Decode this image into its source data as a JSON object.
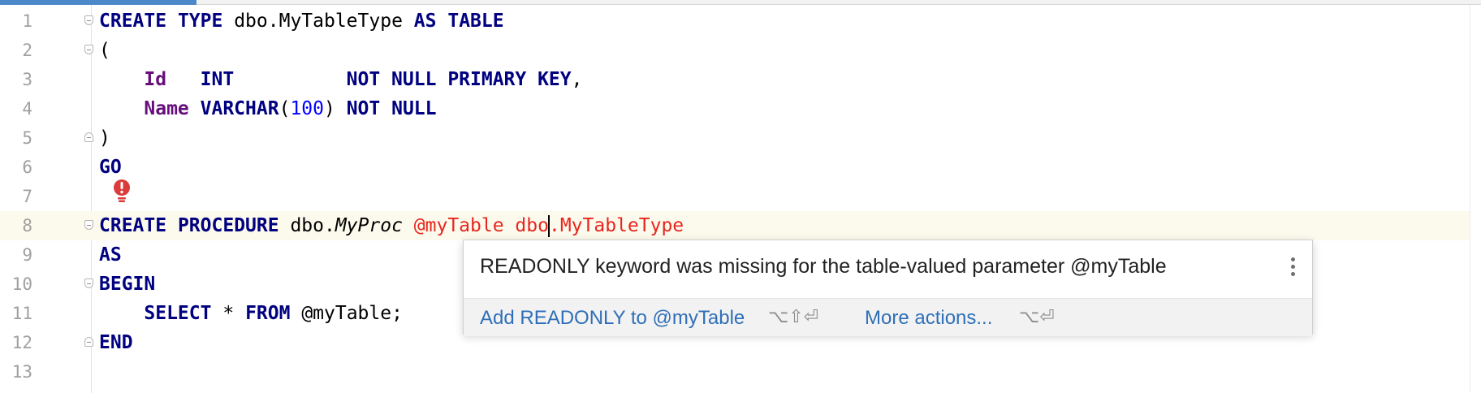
{
  "editor": {
    "line_numbers": [
      "1",
      "2",
      "3",
      "4",
      "5",
      "6",
      "7",
      "8",
      "9",
      "10",
      "11",
      "12",
      "13"
    ],
    "code": {
      "l1": {
        "create": "CREATE",
        "type": "TYPE",
        "name": "dbo.MyTableType",
        "as": "AS",
        "table": "TABLE"
      },
      "l2": {
        "paren": "("
      },
      "l3": {
        "col": "Id",
        "type": "INT",
        "notnull": "NOT NULL",
        "pk": "PRIMARY KEY",
        "comma": ","
      },
      "l4": {
        "col": "Name",
        "type": "VARCHAR",
        "open": "(",
        "num": "100",
        "close": ")",
        "notnull": "NOT NULL"
      },
      "l5": {
        "paren": ")"
      },
      "l6": {
        "go": "GO"
      },
      "l8": {
        "create": "CREATE",
        "procedure": "PROCEDURE",
        "schema": "dbo.",
        "proc": "MyProc",
        "param": "@myTable",
        "ptype_schema": "dbo",
        "ptype_rest": ".MyTableType"
      },
      "l9": {
        "as": "AS"
      },
      "l10": {
        "begin": "BEGIN"
      },
      "l11": {
        "select": "SELECT",
        "star": "*",
        "from": "FROM",
        "source": "@myTable;"
      },
      "l12": {
        "end": "END"
      }
    },
    "current_line": 8,
    "colors": {
      "keyword": "#000080",
      "column": "#660e7a",
      "number": "#0000ff",
      "error": "#e8261f",
      "line_highlight": "#fcfaed"
    }
  },
  "intention": {
    "icon": "error-bulb-icon",
    "message": "READONLY keyword was missing for the table-valued parameter @myTable",
    "primary_action": "Add READONLY to @myTable",
    "primary_shortcut": "⌥⇧⏎",
    "more_actions": "More actions...",
    "more_shortcut": "⌥⏎",
    "menu_icon": "kebab-menu-icon"
  }
}
